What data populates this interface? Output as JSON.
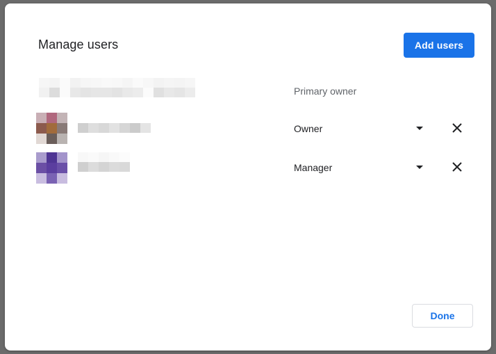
{
  "dialog": {
    "title": "Manage users",
    "add_button_label": "Add users",
    "done_button_label": "Done"
  },
  "users": [
    {
      "role": "Primary owner",
      "editable": false
    },
    {
      "role": "Owner",
      "editable": true
    },
    {
      "role": "Manager",
      "editable": true
    }
  ],
  "icons": {
    "role_dropdown": "caret-down-icon",
    "remove_user": "close-icon"
  },
  "colors": {
    "primary_button_bg": "#1a73e8",
    "primary_button_text": "#ffffff",
    "secondary_button_text": "#1a73e8",
    "dialog_bg": "#ffffff",
    "backdrop": "#6b6b6b"
  }
}
